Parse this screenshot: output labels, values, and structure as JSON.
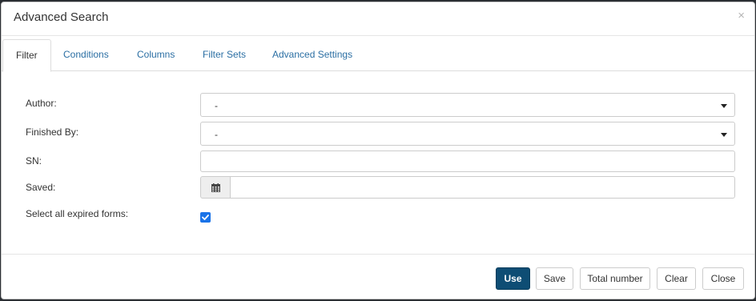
{
  "dialog": {
    "title": "Advanced Search",
    "close_glyph": "×"
  },
  "tabs": [
    {
      "label": "Filter",
      "active": true
    },
    {
      "label": "Conditions",
      "active": false
    },
    {
      "label": "Columns",
      "active": false
    },
    {
      "label": "Filter Sets",
      "active": false
    },
    {
      "label": "Advanced Settings",
      "active": false
    }
  ],
  "form": {
    "author": {
      "label": "Author:",
      "value": "-"
    },
    "finished_by": {
      "label": "Finished By:",
      "value": "-"
    },
    "sn": {
      "label": "SN:",
      "value": ""
    },
    "saved": {
      "label": "Saved:",
      "value": "",
      "icon": "calendar-icon"
    },
    "expired": {
      "label": "Select all expired forms:",
      "checked": true
    }
  },
  "footer": {
    "use": "Use",
    "save": "Save",
    "total_number": "Total number",
    "clear": "Clear",
    "close": "Close"
  },
  "colors": {
    "link": "#2a6ea3",
    "primary_button": "#0e4d74",
    "checkbox": "#1a73e8"
  }
}
